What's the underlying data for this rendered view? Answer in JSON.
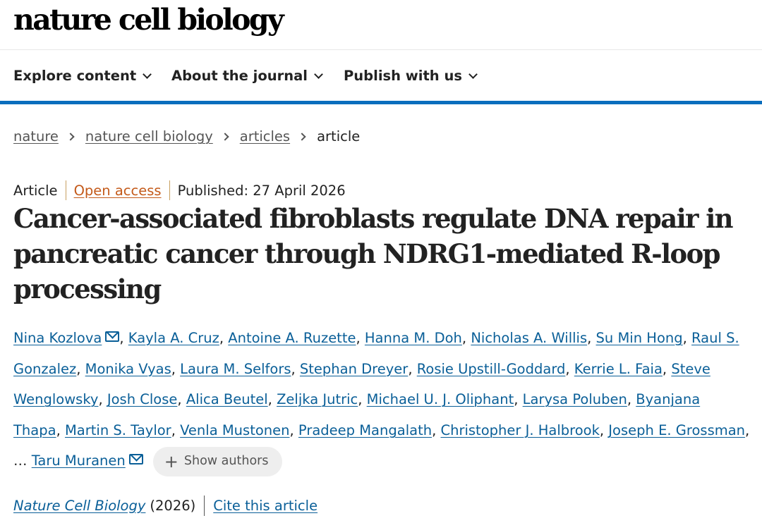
{
  "header": {
    "logo": "nature cell biology"
  },
  "nav": [
    {
      "label": "Explore content"
    },
    {
      "label": "About the journal"
    },
    {
      "label": "Publish with us"
    }
  ],
  "breadcrumb": [
    "nature",
    "nature cell biology",
    "articles",
    "article"
  ],
  "meta": {
    "type": "Article",
    "access": "Open access",
    "published": "Published: 27 April 2026"
  },
  "article": {
    "title": "Cancer-associated fibroblasts regulate DNA repair in pancreatic cancer through NDRG1-mediated R-loop processing"
  },
  "authors": [
    "Nina Kozlova",
    "Kayla A. Cruz",
    "Antoine A. Ruzette",
    "Hanna M. Doh",
    "Nicholas A. Willis",
    "Su Min Hong",
    "Raul S. Gonzalez",
    "Monika Vyas",
    "Laura M. Selfors",
    "Stephan Dreyer",
    "Rosie Upstill-Goddard",
    "Kerrie L. Faia",
    "Steve Wenglowsky",
    "Josh Close",
    "Alica Beutel",
    "Zeljka Jutric",
    "Michael U. J. Oliphant",
    "Larysa Poluben",
    "Byanjana Thapa",
    "Martin S. Taylor",
    "Venla Mustonen",
    "Pradeep Mangalath",
    "Christopher J. Halbrook",
    "Joseph E. Grossman",
    "Taru Muranen"
  ],
  "authors_ellipsis": "…",
  "show_authors_label": "Show authors",
  "citation": {
    "journal": "Nature Cell Biology",
    "year": "(2026)",
    "cite_label": "Cite this article"
  },
  "colors": {
    "link": "#0a5f98",
    "nav_border": "#0a6ebd",
    "open_access": "#c45a1a"
  },
  "icons": [
    "chevron-down-icon",
    "chevron-right-icon",
    "mail-icon",
    "plus-icon"
  ]
}
